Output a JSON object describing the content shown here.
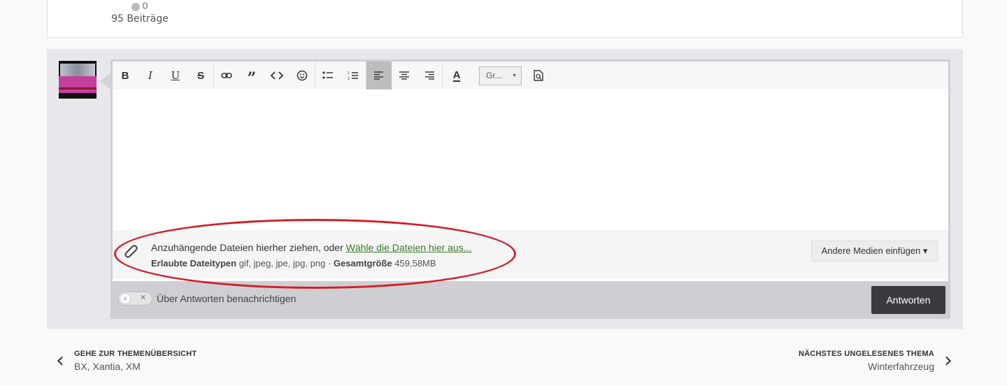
{
  "post": {
    "reputation": "0",
    "post_count": "95 Beiträge"
  },
  "toolbar": {
    "bold": "B",
    "italic": "I",
    "underline": "U",
    "strike": "S",
    "font_select": "Gr...",
    "font_color": "A"
  },
  "attachments": {
    "drop_text": "Anzuhängende Dateien hierher ziehen, oder ",
    "choose_link": "Wähle die Dateien hier aus...",
    "allowed_label": "Erlaubte Dateitypen",
    "allowed_types": " gif, jpeg, jpe, jpg, png · ",
    "total_label": "Gesamtgröße",
    "total_size": " 459,58MB",
    "media_button": "Andere Medien einfügen ▾"
  },
  "notify_label": "Über Antworten benachrichtigen",
  "reply_button": "Antworten",
  "nav": {
    "prev_label": "GEHE ZUR THEMENÜBERSICHT",
    "prev_sub": "BX, Xantia, XM",
    "next_label": "NÄCHSTES UNGELESENES THEMA",
    "next_sub": "Winterfahrzeug"
  },
  "colors": {
    "reply_button_bg": "#3a3b40",
    "link": "#3a7a2a",
    "highlight_oval": "#d0202a",
    "active_tool": "#bdbdbd"
  }
}
